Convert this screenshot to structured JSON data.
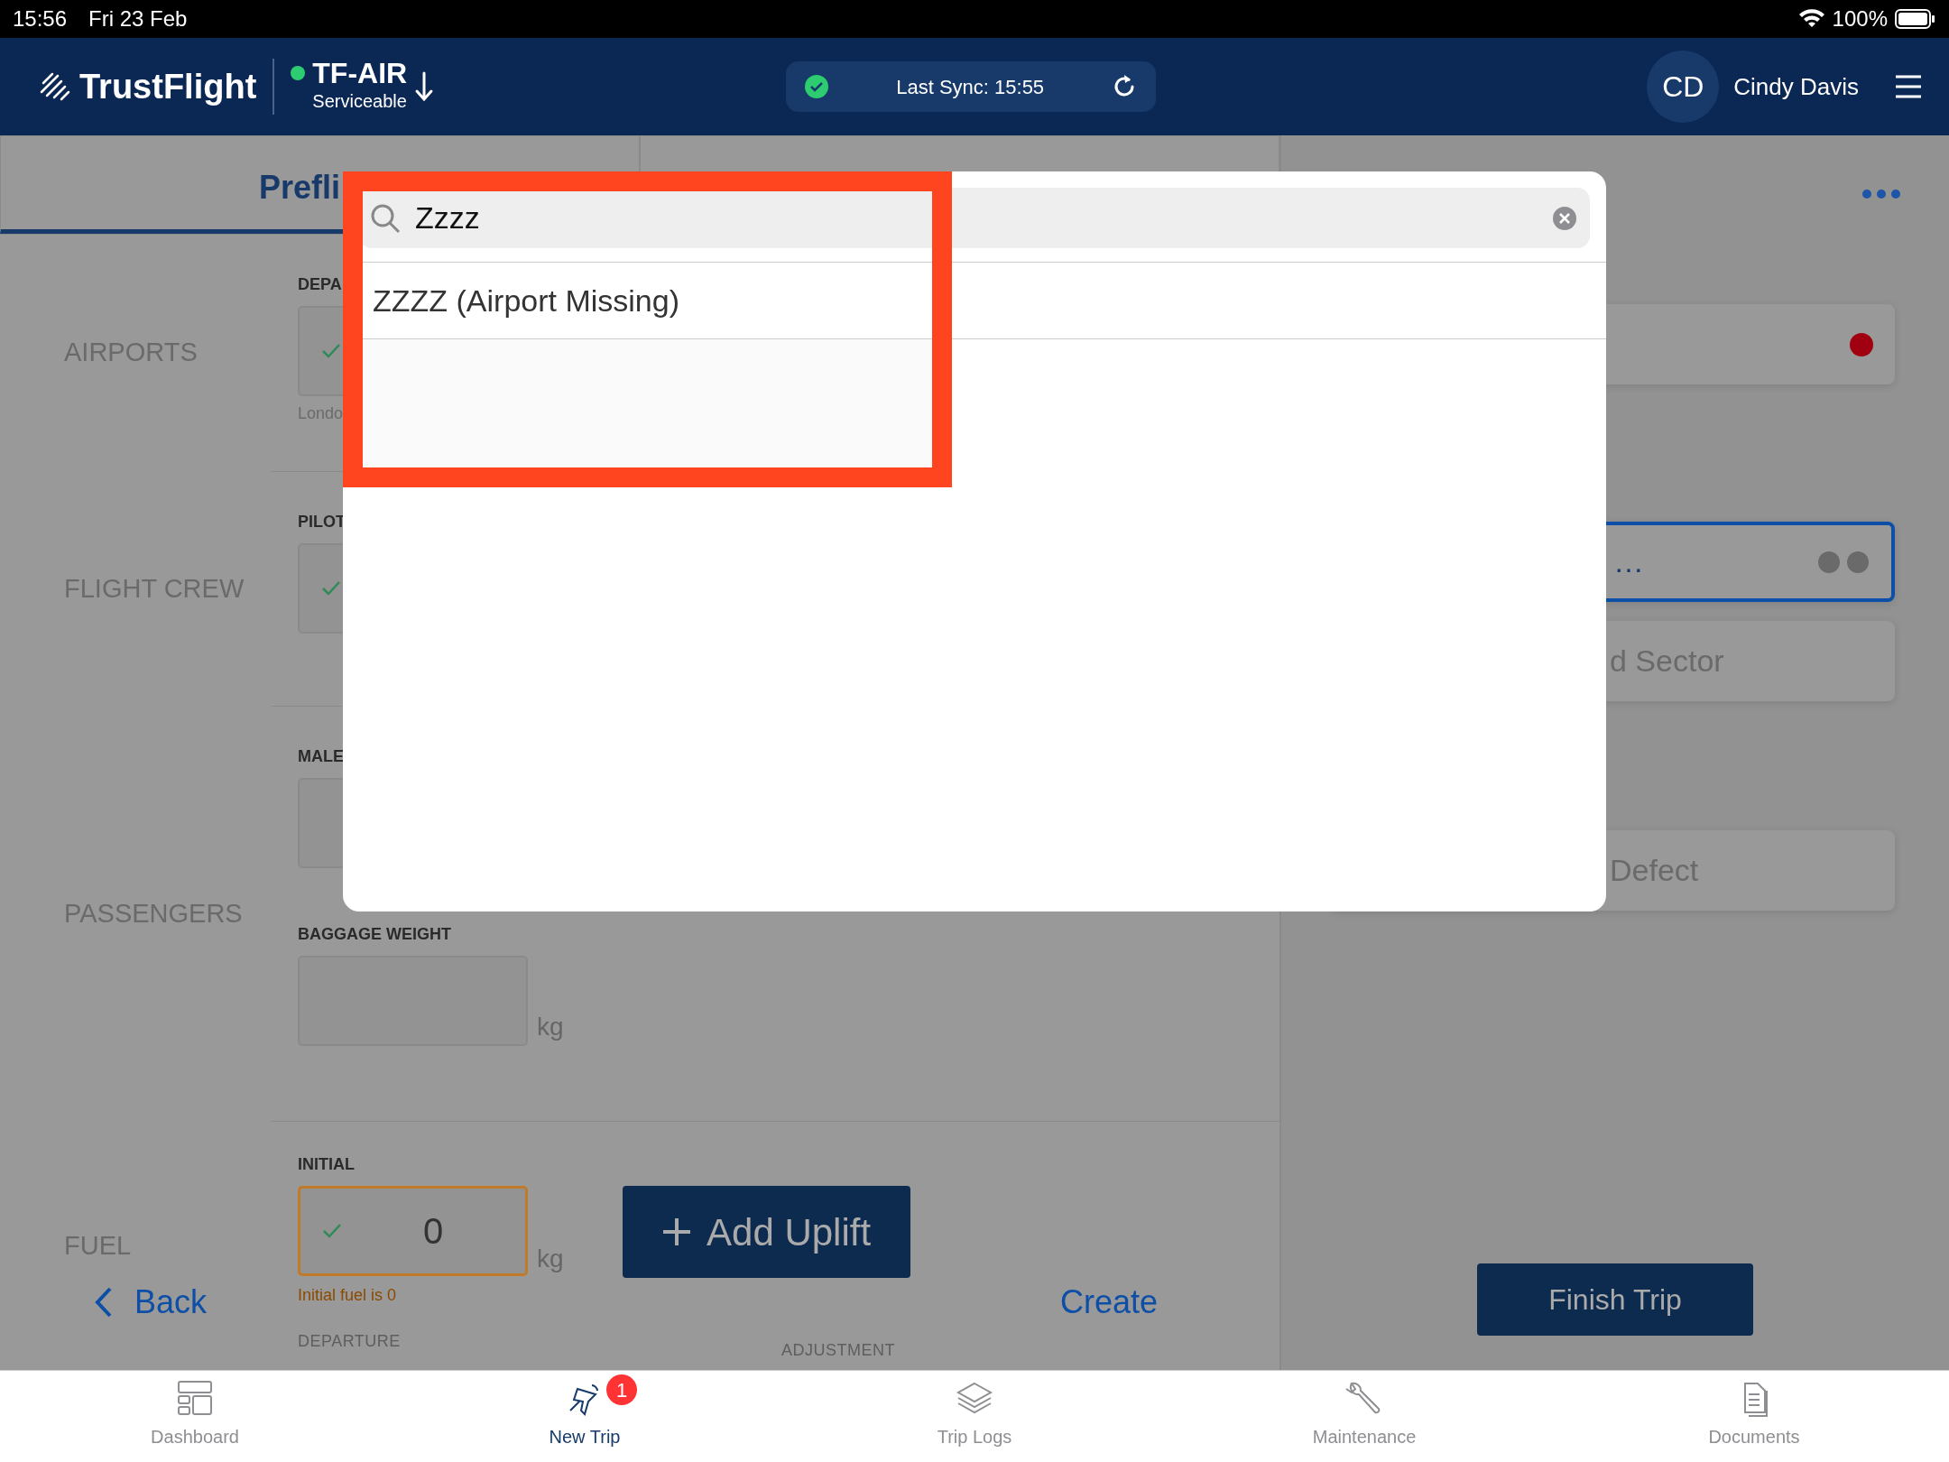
{
  "status_bar": {
    "time": "15:56",
    "date": "Fri 23 Feb",
    "battery": "100%"
  },
  "header": {
    "brand": "TrustFlight",
    "aircraft": {
      "registration": "TF-AIR",
      "status": "Serviceable"
    },
    "sync": {
      "text": "Last Sync: 15:55",
      "ok": true
    },
    "user": {
      "initials": "CD",
      "name": "Cindy Davis"
    }
  },
  "tabs": [
    {
      "label": "Prefli",
      "selected": true
    }
  ],
  "sections": [
    {
      "title": "AIRPORTS",
      "fields": [
        {
          "label": "DEPA",
          "checked": true,
          "hint": "Londo"
        }
      ]
    },
    {
      "title": "FLIGHT CREW",
      "fields": [
        {
          "label": "PILOT",
          "checked": true
        }
      ]
    },
    {
      "title": "PASSENGERS",
      "fields": [
        {
          "label": "MALE",
          "checked": false
        },
        {
          "label": "BAGGAGE WEIGHT",
          "checked": false,
          "unit": "kg"
        }
      ]
    }
  ],
  "fuel": {
    "title": "FUEL",
    "label": "INITIAL",
    "value": "0",
    "checked": true,
    "unit": "kg",
    "warning": "Initial fuel is 0",
    "add_button": "Add Uplift",
    "columns": [
      "DEPARTURE",
      "ADJUSTMENT"
    ]
  },
  "footer": {
    "back": "Back",
    "create": "Create"
  },
  "right_panel": {
    "cards": [
      {
        "kind": "status",
        "color": "#a0000f"
      },
      {
        "kind": "input",
        "text": "…",
        "focused": true
      },
      {
        "kind": "button",
        "text": "d Sector"
      },
      {
        "kind": "button",
        "text": "Defect"
      }
    ],
    "finish": "Finish Trip"
  },
  "modal": {
    "search": {
      "value": "Zzzz"
    },
    "results": [
      "ZZZZ (Airport Missing)"
    ]
  },
  "nav": [
    {
      "label": "Dashboard",
      "selected": false
    },
    {
      "label": "New Trip",
      "selected": true,
      "badge": "1"
    },
    {
      "label": "Trip Logs",
      "selected": false
    },
    {
      "label": "Maintenance",
      "selected": false
    },
    {
      "label": "Documents",
      "selected": false
    }
  ]
}
